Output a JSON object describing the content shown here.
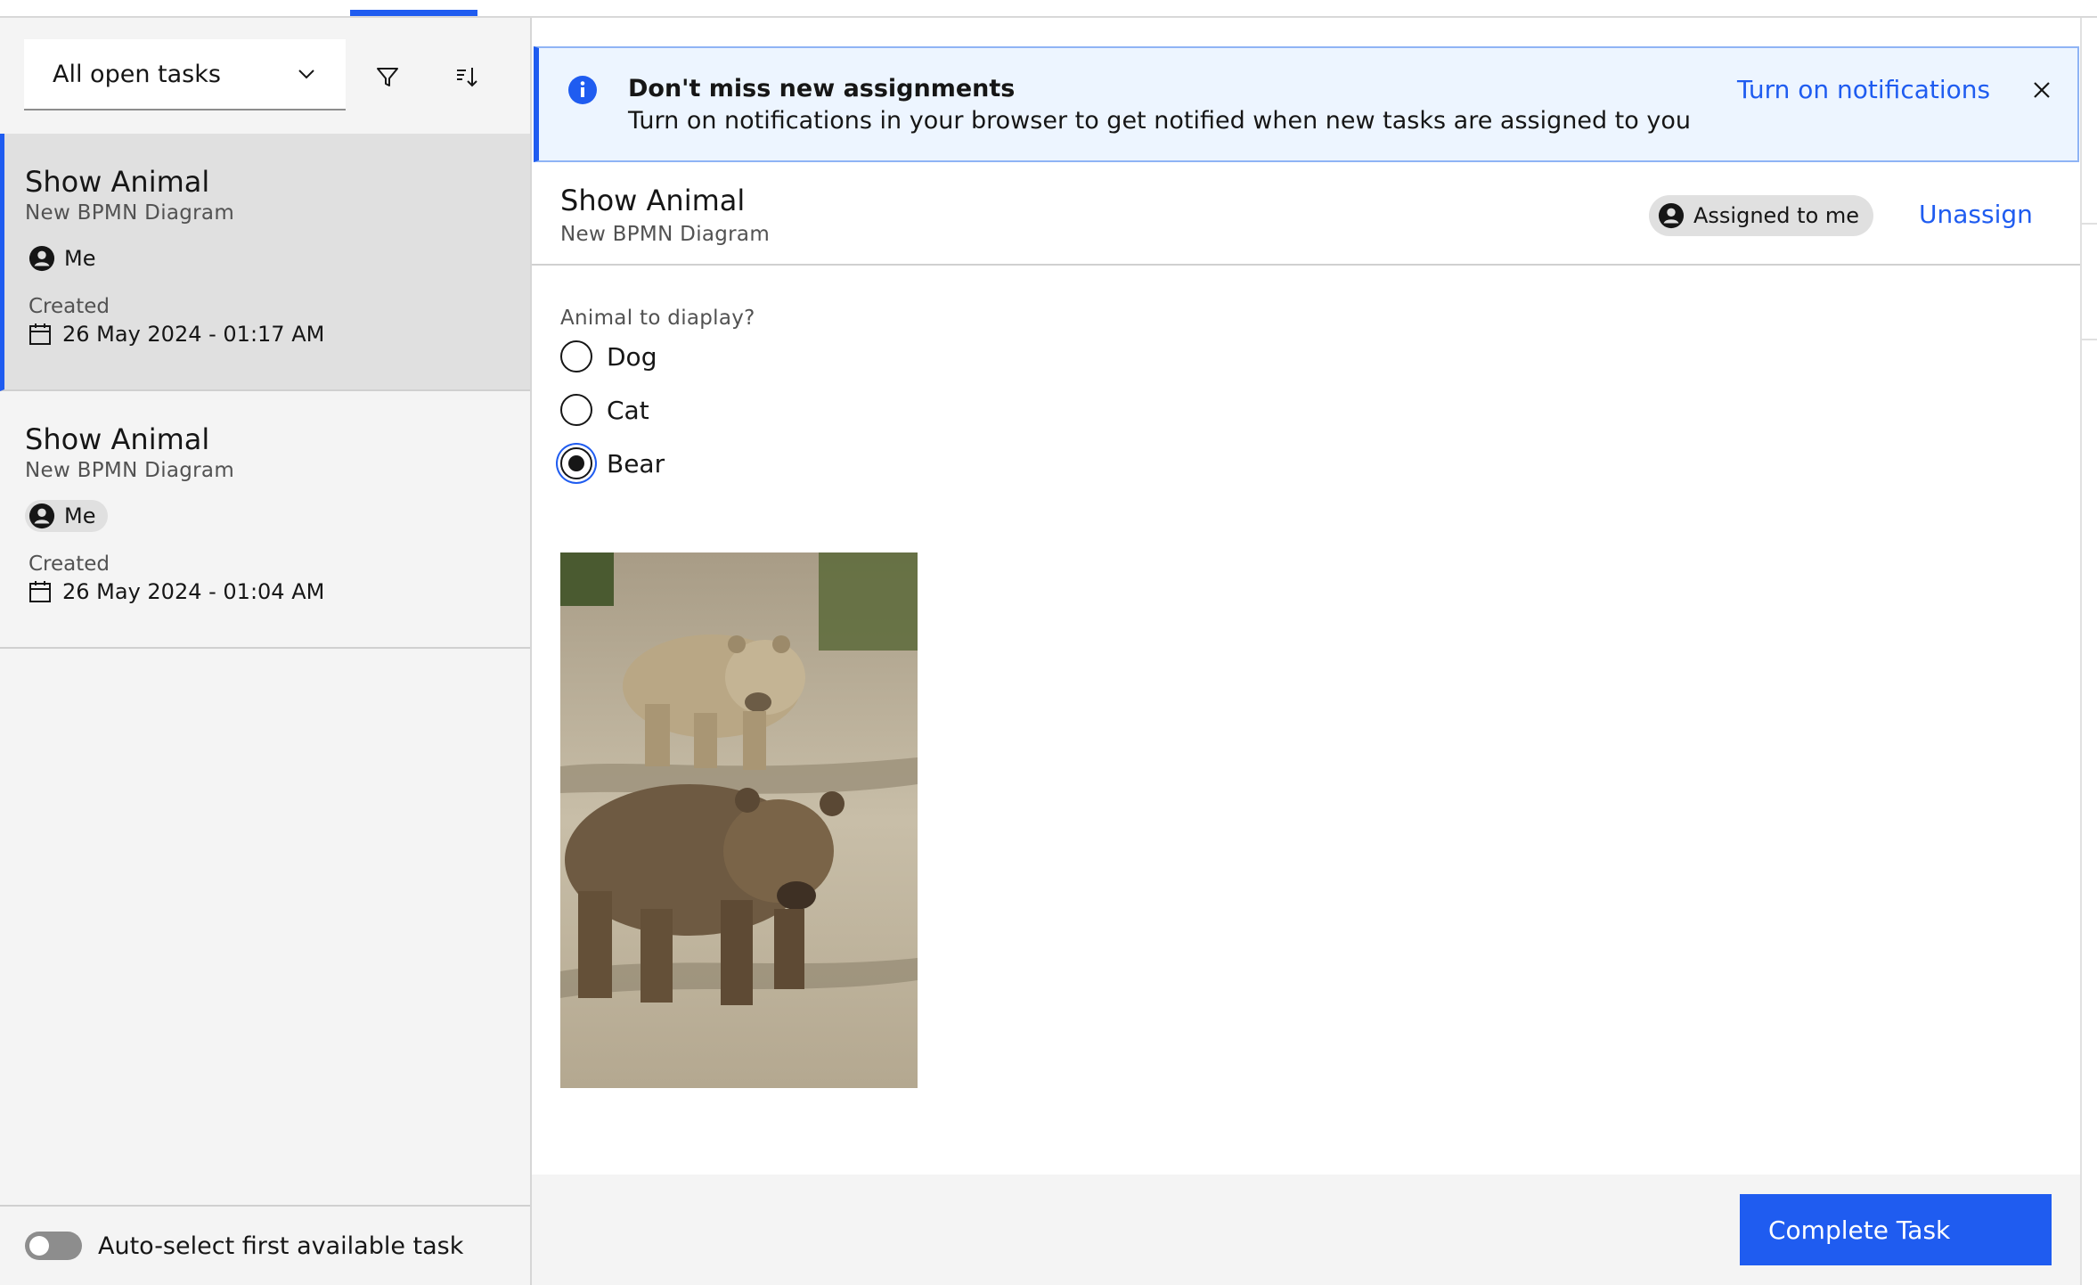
{
  "filters": {
    "task_filter_value": "All open tasks",
    "filter_icon": "filter-icon",
    "sort_icon": "sort-icon"
  },
  "tasks": [
    {
      "title": "Show Animal",
      "process": "New BPMN Diagram",
      "assignee": "Me",
      "created_label": "Created",
      "created_date": "26 May 2024 - 01:17 AM",
      "selected": true
    },
    {
      "title": "Show Animal",
      "process": "New BPMN Diagram",
      "assignee": "Me",
      "created_label": "Created",
      "created_date": "26 May 2024 - 01:04 AM",
      "selected": false
    }
  ],
  "left_footer": {
    "toggle_label": "Auto-select first available task",
    "toggle_on": false
  },
  "notification": {
    "title": "Don't miss new assignments",
    "text": "Turn on notifications in your browser to get notified when new tasks are assigned to you",
    "action": "Turn on notifications"
  },
  "task_detail": {
    "title": "Show Animal",
    "process": "New BPMN Diagram",
    "assigned_badge": "Assigned to me",
    "unassign": "Unassign"
  },
  "form": {
    "question": "Animal to diaplay?",
    "options": [
      "Dog",
      "Cat",
      "Bear"
    ],
    "selected": "Bear"
  },
  "actions": {
    "complete": "Complete Task"
  },
  "colors": {
    "accent": "#1f5cf0",
    "info_bg": "#edf5ff"
  }
}
